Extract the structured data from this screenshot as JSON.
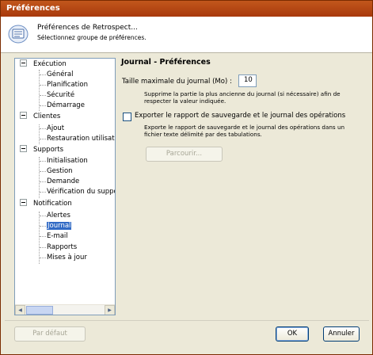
{
  "window": {
    "title": "Préférences"
  },
  "header": {
    "title": "Préférences de Retrospect...",
    "subtitle": "Sélectionnez groupe de préférences.",
    "icon": "preferences-card-icon"
  },
  "tree": {
    "groups": [
      {
        "label": "Exécution",
        "children": [
          "Général",
          "Planification",
          "Sécurité",
          "Démarrage"
        ]
      },
      {
        "label": "Clientes",
        "children": [
          "Ajout",
          "Restauration utilisateur"
        ]
      },
      {
        "label": "Supports",
        "children": [
          "Initialisation",
          "Gestion",
          "Demande",
          "Vérification du support"
        ]
      },
      {
        "label": "Notification",
        "children": [
          "Alertes",
          "Journal",
          "E-mail",
          "Rapports",
          "Mises à jour"
        ]
      }
    ],
    "selected": "Journal"
  },
  "panel": {
    "title": "Journal - Préférences",
    "max_size_label": "Taille maximale du journal (Mo) :",
    "max_size_value": "10",
    "max_size_desc": "Supprime la partie la plus ancienne du journal (si nécessaire) afin de respecter la valeur indiquée.",
    "export_label": "Exporter le rapport de sauvegarde et le journal des opérations",
    "export_checked": false,
    "export_desc": "Exporte le rapport de sauvegarde et le journal des opérations dans un fichier texte délimité par des tabulations.",
    "browse_label": "Parcourir..."
  },
  "footer": {
    "default_label": "Par défaut",
    "ok_label": "OK",
    "cancel_label": "Annuler"
  },
  "colors": {
    "titlebar": "#b0420f",
    "selection": "#316ac5"
  }
}
